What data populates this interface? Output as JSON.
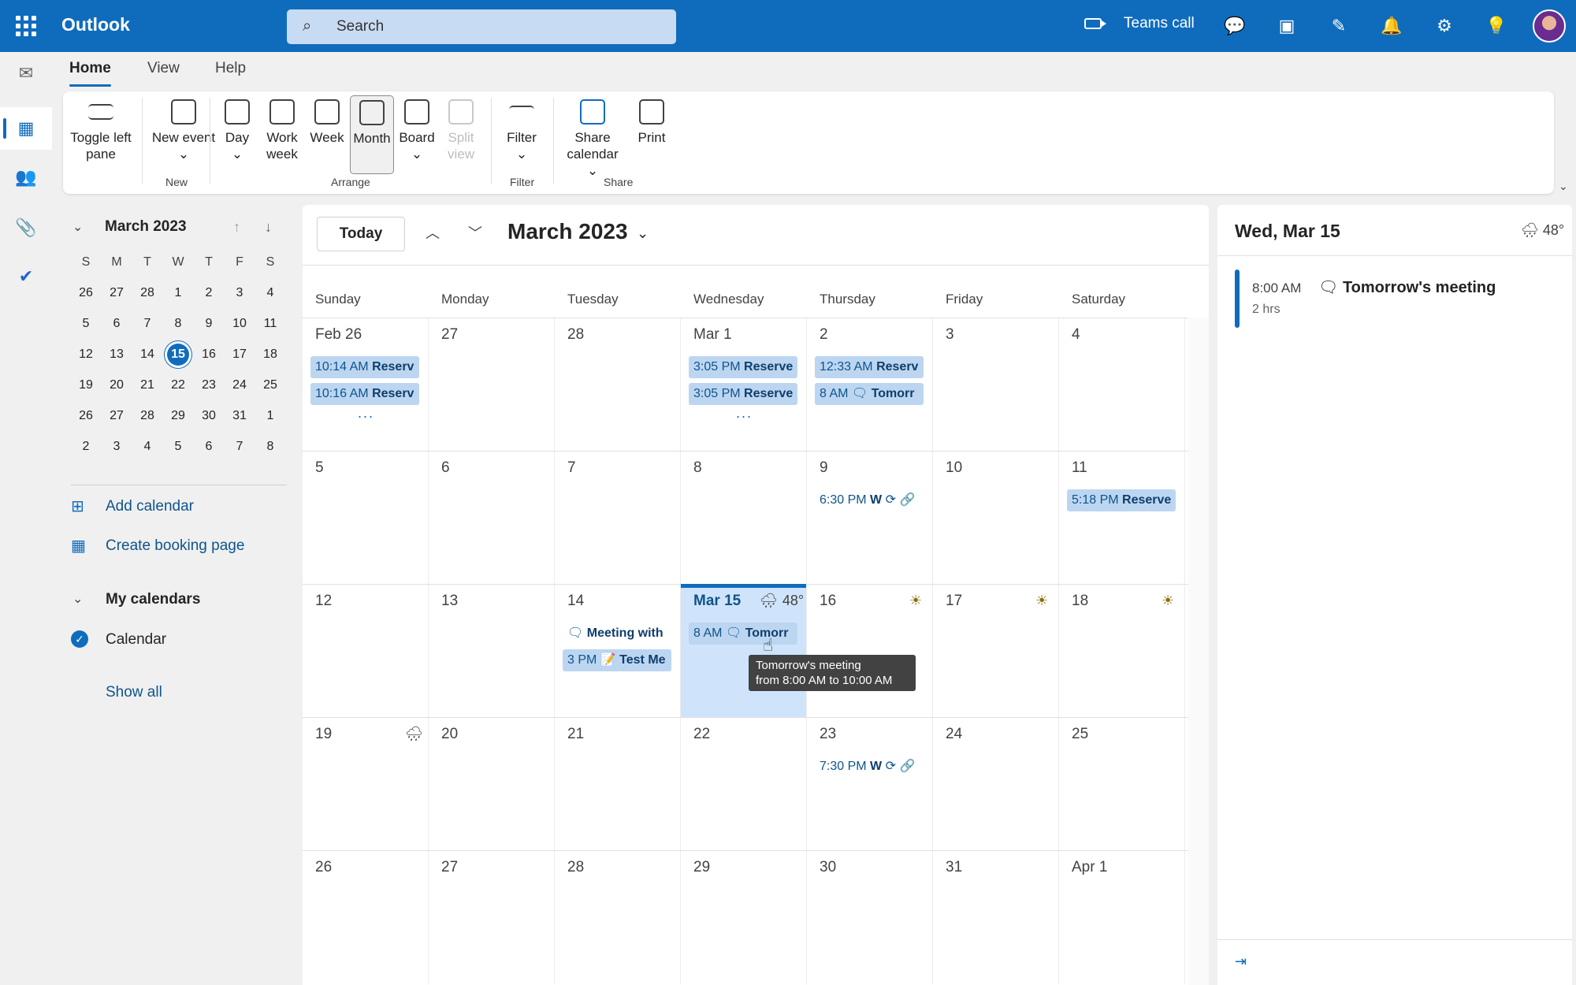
{
  "app": {
    "name": "Outlook"
  },
  "search": {
    "placeholder": "Search"
  },
  "topbar": {
    "teams_call": "Teams call"
  },
  "ribbon": {
    "tabs": [
      "Home",
      "View",
      "Help"
    ],
    "buttons": {
      "toggle_left_pane": "Toggle left pane",
      "new_event": "New event",
      "day": "Day",
      "work_week": "Work week",
      "week": "Week",
      "month": "Month",
      "board": "Board",
      "split_view": "Split view",
      "filter": "Filter",
      "share_calendar": "Share calendar",
      "print": "Print"
    },
    "groups": {
      "new": "New",
      "arrange": "Arrange",
      "filter": "Filter",
      "share": "Share"
    }
  },
  "mini_calendar": {
    "title": "March 2023",
    "dow": [
      "S",
      "M",
      "T",
      "W",
      "T",
      "F",
      "S"
    ],
    "weeks": [
      [
        "26",
        "27",
        "28",
        "1",
        "2",
        "3",
        "4"
      ],
      [
        "5",
        "6",
        "7",
        "8",
        "9",
        "10",
        "11"
      ],
      [
        "12",
        "13",
        "14",
        "15",
        "16",
        "17",
        "18"
      ],
      [
        "19",
        "20",
        "21",
        "22",
        "23",
        "24",
        "25"
      ],
      [
        "26",
        "27",
        "28",
        "29",
        "30",
        "31",
        "1"
      ],
      [
        "2",
        "3",
        "4",
        "5",
        "6",
        "7",
        "8"
      ]
    ],
    "today": "15"
  },
  "sidebar": {
    "add_calendar": "Add calendar",
    "create_booking": "Create booking page",
    "my_calendars": "My calendars",
    "calendar": "Calendar",
    "show_all": "Show all"
  },
  "main": {
    "today_button": "Today",
    "title": "March 2023",
    "dow": [
      "Sunday",
      "Monday",
      "Tuesday",
      "Wednesday",
      "Thursday",
      "Friday",
      "Saturday"
    ],
    "weeks": [
      [
        "Feb 26",
        "27",
        "28",
        "Mar 1",
        "2",
        "3",
        "4"
      ],
      [
        "5",
        "6",
        "7",
        "8",
        "9",
        "10",
        "11"
      ],
      [
        "12",
        "13",
        "14",
        "Mar 15",
        "16",
        "17",
        "18"
      ],
      [
        "19",
        "20",
        "21",
        "22",
        "23",
        "24",
        "25"
      ],
      [
        "26",
        "27",
        "28",
        "29",
        "30",
        "31",
        "Apr 1"
      ]
    ],
    "events": {
      "w0_sun_1": {
        "time": "10:14 AM",
        "title": "Reserv"
      },
      "w0_sun_2": {
        "time": "10:16 AM",
        "title": "Reserv"
      },
      "w0_wed_1": {
        "time": "3:05 PM",
        "title": "Reserve"
      },
      "w0_wed_2": {
        "time": "3:05 PM",
        "title": "Reserve"
      },
      "w0_thu_1": {
        "time": "12:33 AM",
        "title": "Reserv"
      },
      "w0_thu_2": {
        "time": "8 AM",
        "title": "Tomorr"
      },
      "w1_thu_1": {
        "time": "6:30 PM",
        "title": "W"
      },
      "w1_sat_1": {
        "time": "5:18 PM",
        "title": "Reserve"
      },
      "w2_tue_1": {
        "title": "Meeting with"
      },
      "w2_tue_2": {
        "time": "3 PM",
        "title": "Test Me"
      },
      "w2_wed_1": {
        "time": "8 AM",
        "title": "Tomorr"
      },
      "w3_thu_1": {
        "time": "7:30 PM",
        "title": "W"
      }
    },
    "more_indicator": "...",
    "weather_temp": "48°"
  },
  "tooltip": {
    "line1": "Tomorrow's meeting",
    "line2": "from 8:00 AM to 10:00 AM"
  },
  "right_pane": {
    "title": "Wed, Mar 15",
    "temp": "48°",
    "event": {
      "time": "8:00 AM",
      "duration": "2 hrs",
      "title": "Tomorrow's meeting"
    }
  },
  "colors": {
    "brand": "#0f6cbd",
    "event_bg": "#bcd6f1",
    "selected_day": "#cfe4fa"
  }
}
